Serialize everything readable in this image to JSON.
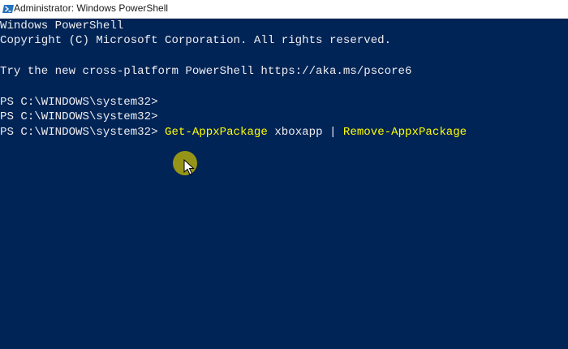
{
  "window": {
    "title": "Administrator: Windows PowerShell",
    "icon": "powershell-icon",
    "background_color": "#012456"
  },
  "console": {
    "text_color": "#eeedf0",
    "command_color": "#ffff00",
    "lines": [
      "Windows PowerShell",
      "Copyright (C) Microsoft Corporation. All rights reserved.",
      "Try the new cross-platform PowerShell https://aka.ms/pscore6",
      "PS C:\\WINDOWS\\system32>",
      "PS C:\\WINDOWS\\system32>"
    ],
    "active_line": {
      "prompt": "PS C:\\WINDOWS\\system32> ",
      "cmdlet1": "Get-AppxPackage",
      "argument": " xboxapp ",
      "pipe": "| ",
      "cmdlet2": "Remove-AppxPackage"
    }
  },
  "cursor": {
    "icon": "mouse-pointer-icon",
    "highlight_color": "#a39e12"
  }
}
